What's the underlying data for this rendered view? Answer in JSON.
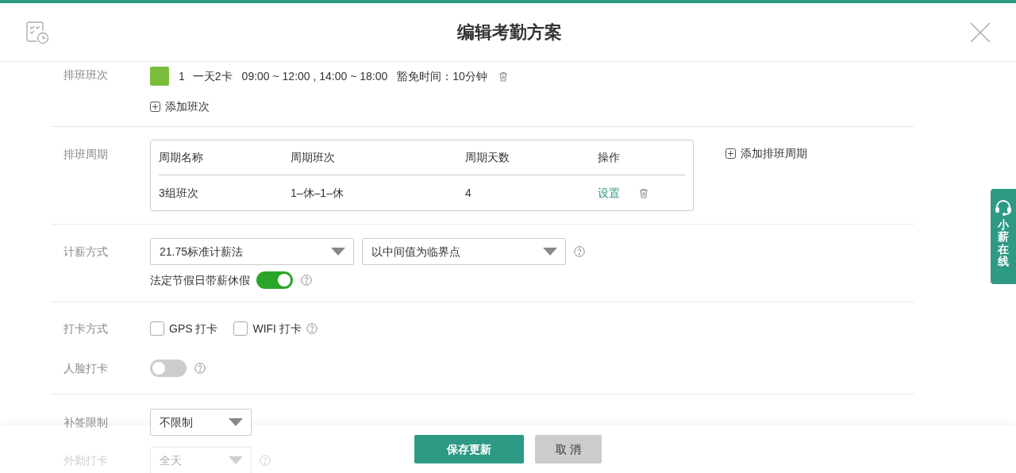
{
  "header": {
    "title": "编辑考勤方案"
  },
  "shifts": {
    "label": "排班班次",
    "items": [
      {
        "color": "#7bbd3a",
        "index": "1",
        "name": "一天2卡",
        "times": "09:00 ~ 12:00 , 14:00 ~ 18:00",
        "grace": "豁免时间：10分钟"
      }
    ],
    "add_label": "添加班次"
  },
  "cycles": {
    "label": "排班周期",
    "columns": [
      "周期名称",
      "周期班次",
      "周期天数",
      "操作"
    ],
    "rows": [
      {
        "name": "3组班次",
        "shifts": "1–休–1–休",
        "days": "4",
        "action": "设置"
      }
    ],
    "add_label": "添加排班周期"
  },
  "pay": {
    "label": "计薪方式",
    "selects": [
      "21.75标准计薪法",
      "以中间值为临界点"
    ],
    "holiday_label": "法定节假日带薪休假",
    "holiday_on": true
  },
  "punch": {
    "label": "打卡方式",
    "options": [
      {
        "label": "GPS 打卡",
        "checked": false
      },
      {
        "label": "WIFI 打卡",
        "checked": false
      }
    ]
  },
  "face": {
    "label": "人脸打卡",
    "on": false
  },
  "supplement": {
    "label": "补签限制",
    "value": "不限制"
  },
  "field": {
    "label": "外勤打卡",
    "value": "全天"
  },
  "footer": {
    "buttons": [
      {
        "label": "保存更新",
        "kind": "primary"
      },
      {
        "label": "取 消",
        "kind": "secondary"
      }
    ]
  },
  "support": {
    "label": "小薪在线"
  }
}
